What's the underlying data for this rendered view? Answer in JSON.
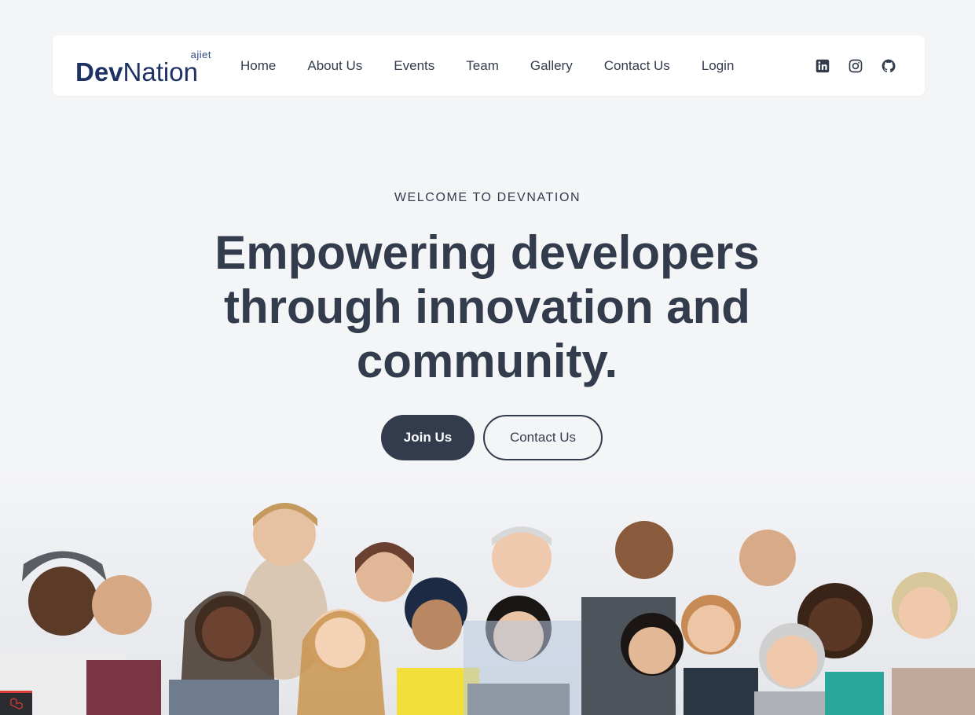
{
  "brand": {
    "sub": "ajiet",
    "name_bold": "Dev",
    "name_light": "Nation"
  },
  "nav": {
    "items": [
      "Home",
      "About Us",
      "Events",
      "Team",
      "Gallery",
      "Contact Us",
      "Login"
    ]
  },
  "social": [
    "linkedin-icon",
    "instagram-icon",
    "github-icon"
  ],
  "hero": {
    "eyebrow": "WELCOME TO DEVNATION",
    "headline": "Empowering developers through innovation and community.",
    "primary_button": "Join Us",
    "secondary_button": "Contact Us"
  },
  "colors": {
    "background": "#f4f5f7",
    "text": "#333c4d",
    "brand": "#1e3264",
    "button_primary": "#333c4d",
    "laravel_accent": "#d83c34"
  },
  "image": {
    "subject": "group-of-diverse-smiling-people"
  }
}
